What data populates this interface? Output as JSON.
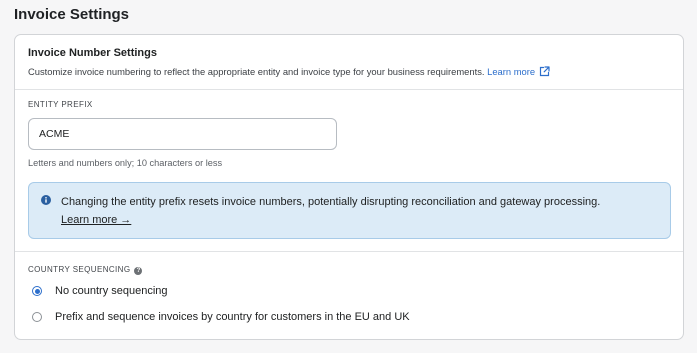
{
  "page": {
    "title": "Invoice Settings"
  },
  "invoice_number_settings": {
    "title": "Invoice Number Settings",
    "description": "Customize invoice numbering to reflect the appropriate entity and invoice type for your business requirements.",
    "learn_more": "Learn more"
  },
  "entity_prefix": {
    "label": "ENTITY PREFIX",
    "value": "ACME",
    "help": "Letters and numbers only; 10 characters or less"
  },
  "banner": {
    "message": "Changing the entity prefix resets invoice numbers, potentially disrupting reconciliation and gateway processing.",
    "link": "Learn more →",
    "icon": "info-icon"
  },
  "country_sequencing": {
    "label": "COUNTRY SEQUENCING",
    "options": [
      {
        "label": "No country sequencing",
        "checked": true
      },
      {
        "label": "Prefix and sequence invoices by country for customers in the EU and UK",
        "checked": false
      }
    ]
  },
  "colors": {
    "accent": "#2c6ecb",
    "banner_bg": "#dcebf7",
    "banner_border": "#a8cbe8"
  }
}
